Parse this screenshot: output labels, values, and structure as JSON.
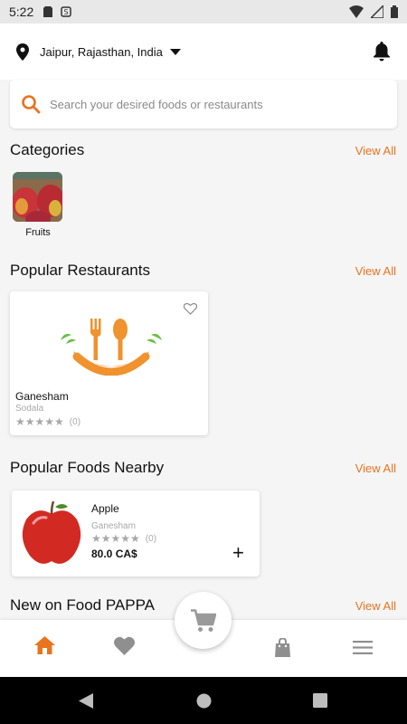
{
  "status_bar": {
    "time": "5:22"
  },
  "header": {
    "location": "Jaipur, Rajasthan, India"
  },
  "search": {
    "placeholder": "Search your desired foods or restaurants"
  },
  "sections": {
    "categories": {
      "title": "Categories",
      "view_all": "View All"
    },
    "popular_restaurants": {
      "title": "Popular Restaurants",
      "view_all": "View All"
    },
    "popular_foods": {
      "title": "Popular Foods Nearby",
      "view_all": "View All"
    },
    "new_on": {
      "title": "New on Food PAPPA",
      "view_all": "View All"
    }
  },
  "categories": [
    {
      "label": "Fruits"
    }
  ],
  "restaurants": [
    {
      "name": "Ganesham",
      "area": "Sodala",
      "rating": 0,
      "reviews": "(0)"
    }
  ],
  "foods": [
    {
      "name": "Apple",
      "restaurant": "Ganesham",
      "rating": 0,
      "reviews": "(0)",
      "price": "80.0 CA$",
      "add": "+"
    }
  ],
  "colors": {
    "accent": "#e8741e",
    "muted": "#a8a8a8"
  },
  "icons": {
    "bottom_nav": [
      "home-icon",
      "heart-icon",
      "cart-icon",
      "bag-icon",
      "menu-icon"
    ],
    "active_tab": "home"
  }
}
